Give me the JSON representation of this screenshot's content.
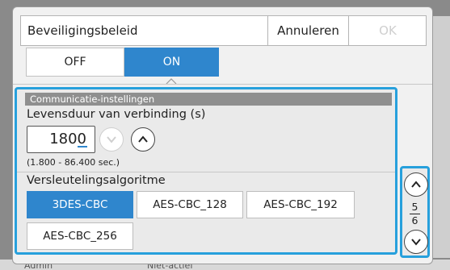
{
  "dialog": {
    "title": "Beveiligingsbeleid",
    "cancel_label": "Annuleren",
    "ok_label": "OK"
  },
  "toggle": {
    "off_label": "OFF",
    "on_label": "ON",
    "selected": "ON"
  },
  "section": {
    "header": "Communicatie-instellingen",
    "lifetime_label": "Levensduur van verbinding (s)",
    "lifetime_value": "1800",
    "lifetime_range": "(1.800 - 86.400 sec.)",
    "encryption_label": "Versleutelingsalgoritme",
    "algorithms": [
      "3DES-CBC",
      "AES-CBC_128",
      "AES-CBC_192",
      "AES-CBC_256"
    ],
    "selected_algorithm": "3DES-CBC"
  },
  "pager": {
    "current": "5",
    "total": "6"
  },
  "background": {
    "status_left": "Admin",
    "status_mid": "Niet-actief"
  },
  "colors": {
    "accent": "#2f86cd",
    "focus_border": "#27a0dc"
  }
}
